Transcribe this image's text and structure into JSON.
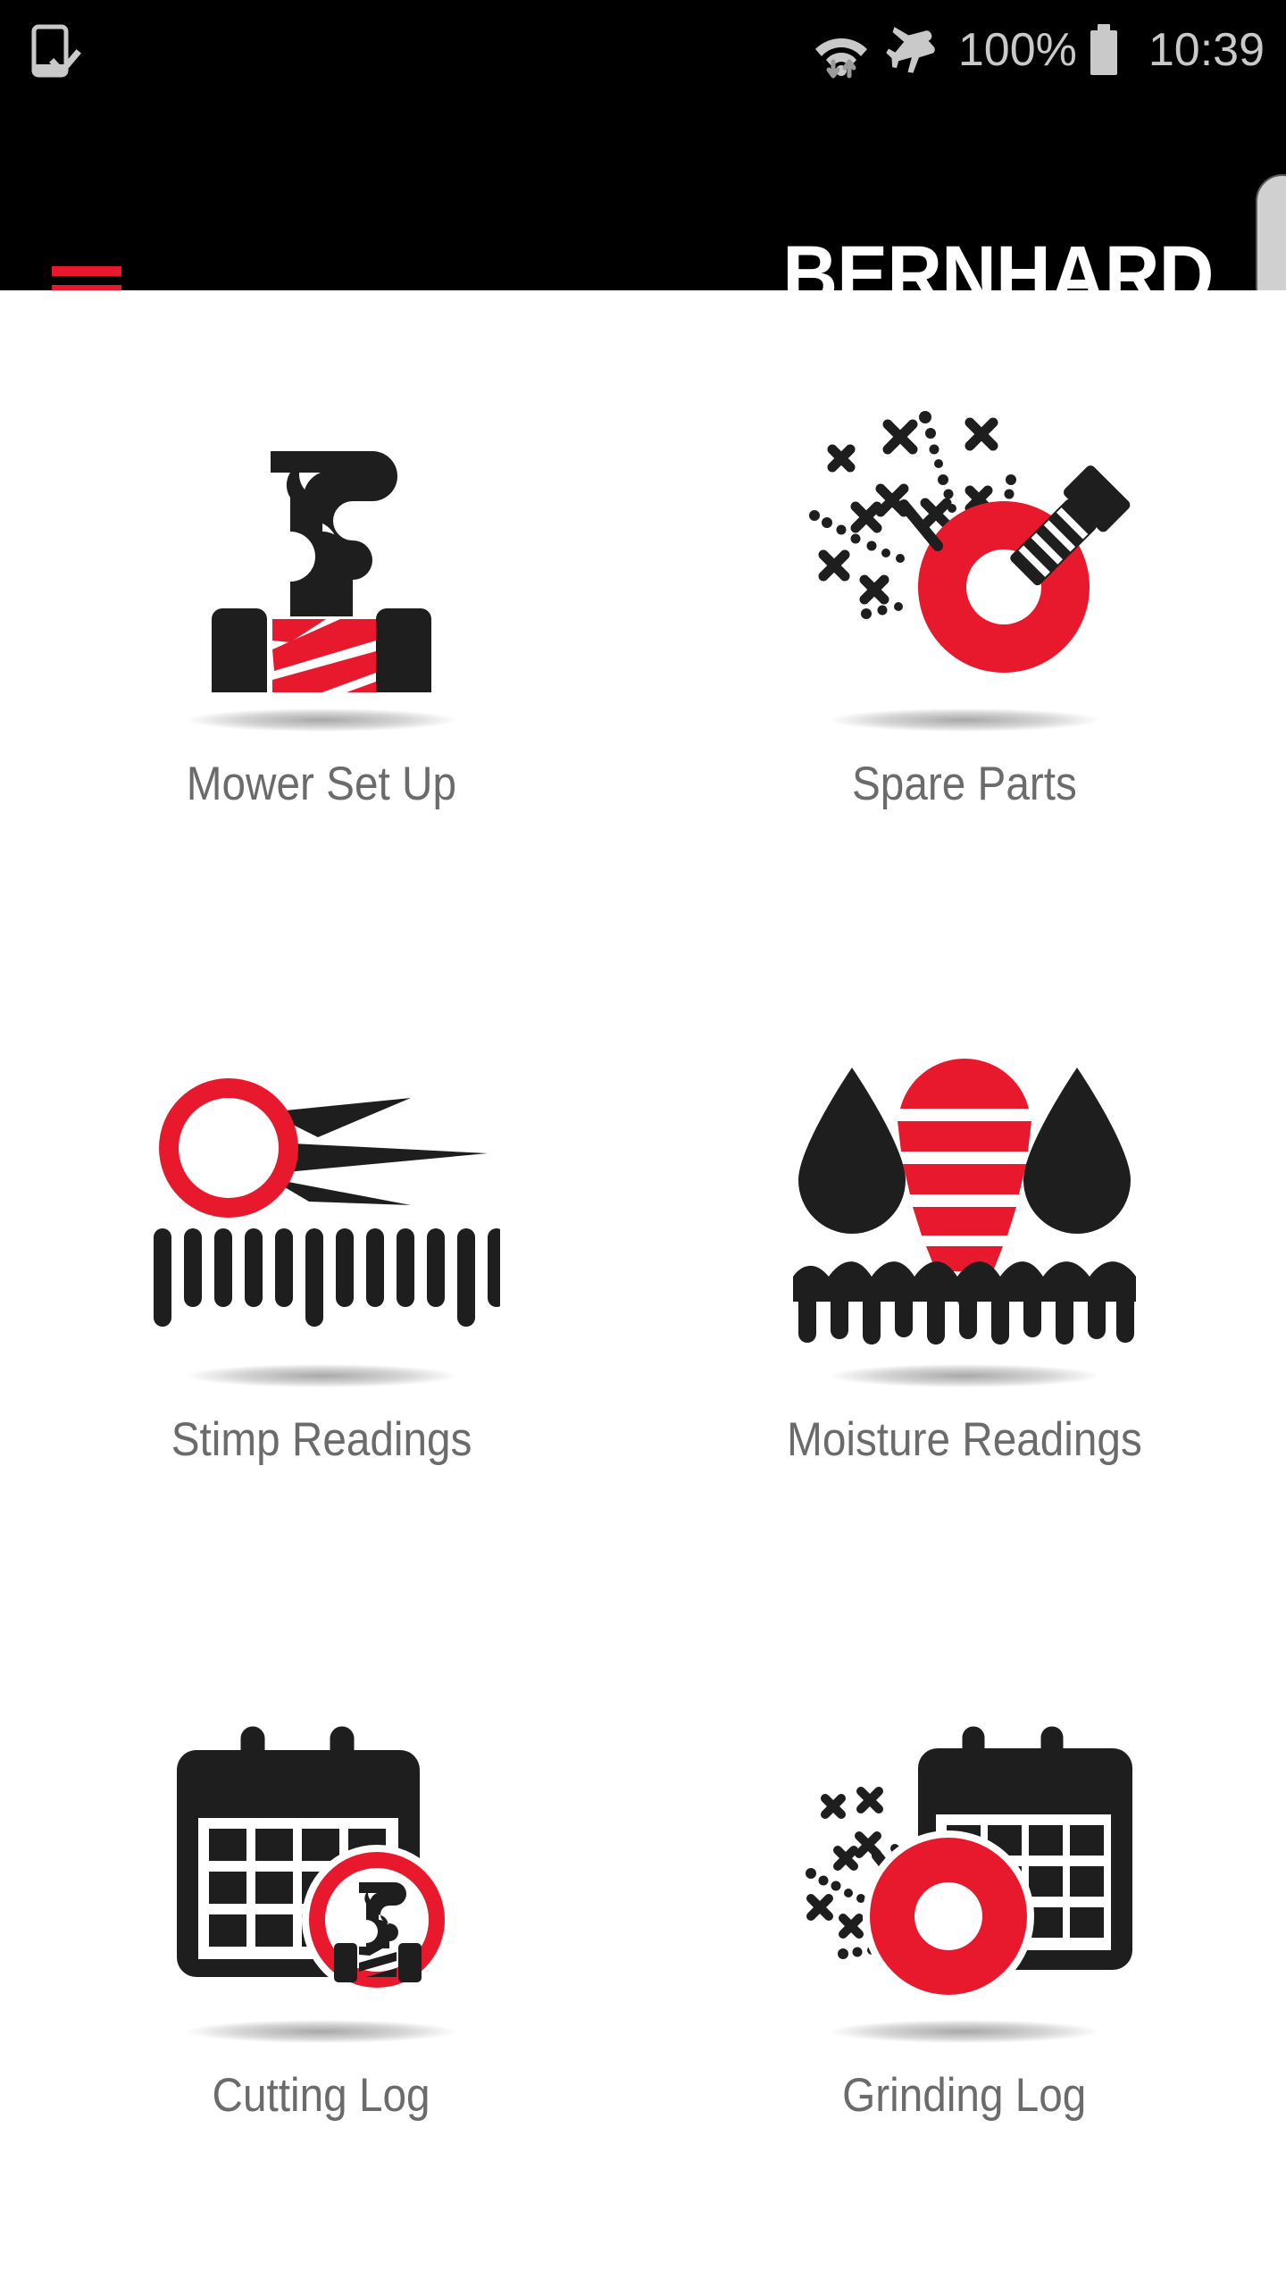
{
  "status_bar": {
    "left_icon": "device-check-icon",
    "wifi_icon": "wifi-data-transfer-icon",
    "airplane_icon": "airplane-mode-icon",
    "battery_percent": "100%",
    "battery_icon": "battery-full-icon",
    "time": "10:39"
  },
  "header": {
    "menu_icon": "hamburger-menu-icon",
    "brand": "BERNHARD",
    "brand_color": "#ffffff",
    "menu_color": "#e8192c",
    "background_color": "#000000"
  },
  "theme": {
    "accent_red": "#e8192c",
    "icon_black": "#1e1e1e",
    "label_gray": "#6b6b6b",
    "page_background": "#ffffff"
  },
  "edge_panel": {
    "name": "side-drawer-handle",
    "fill": "#d0d0d0",
    "border": "#5a5a5a"
  },
  "menu": {
    "items": [
      {
        "label": "Mower Set Up",
        "icon": "mower-reel-icon"
      },
      {
        "label": "Spare Parts",
        "icon": "grinding-wheel-bolt-icon"
      },
      {
        "label": "Stimp Readings",
        "icon": "golf-ball-ruler-icon"
      },
      {
        "label": "Moisture Readings",
        "icon": "water-drops-turf-icon"
      },
      {
        "label": "Cutting Log",
        "icon": "calendar-mower-icon"
      },
      {
        "label": "Grinding Log",
        "icon": "calendar-grinding-wheel-icon"
      }
    ]
  }
}
